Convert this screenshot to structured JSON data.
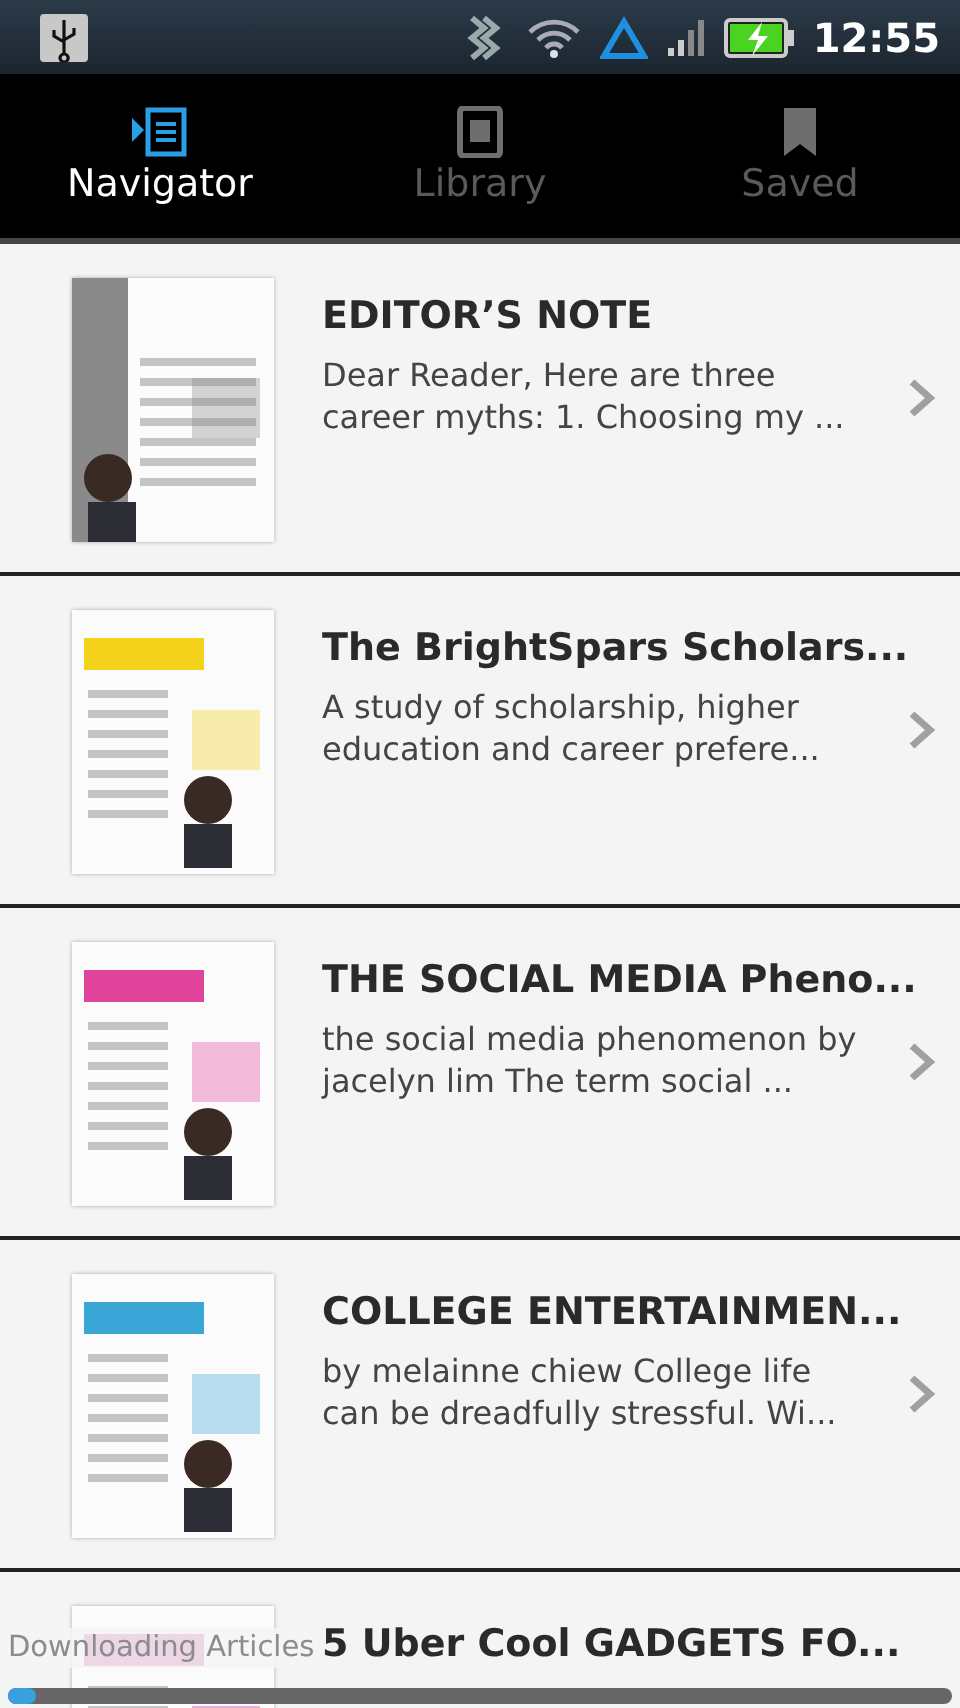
{
  "status_bar": {
    "time": "12:55"
  },
  "tabs": [
    {
      "label": "Navigator",
      "selected": true,
      "kind": "navigator"
    },
    {
      "label": "Library",
      "selected": false,
      "kind": "library"
    },
    {
      "label": "Saved",
      "selected": false,
      "kind": "saved"
    }
  ],
  "articles": [
    {
      "title": "EDITOR’S NOTE",
      "summary": " Dear Reader, Here are three career myths: 1. Choosing my ..."
    },
    {
      "title": "The BrightSpars Scholars...",
      "summary": " A study of scholarship, higher education and career prefere..."
    },
    {
      "title": "THE SOCIAL MEDIA Pheno...",
      "summary": " the social media phenomenon by jacelyn lim The term social ..."
    },
    {
      "title": "COLLEGE ENTERTAINMEN...",
      "summary": " by melainne chiew College life can be dreadfully stressful. Wi..."
    },
    {
      "title": "5 Uber Cool GADGETS FO..."
    }
  ],
  "download": {
    "label": "Downloading Articles",
    "level": 0.03
  }
}
